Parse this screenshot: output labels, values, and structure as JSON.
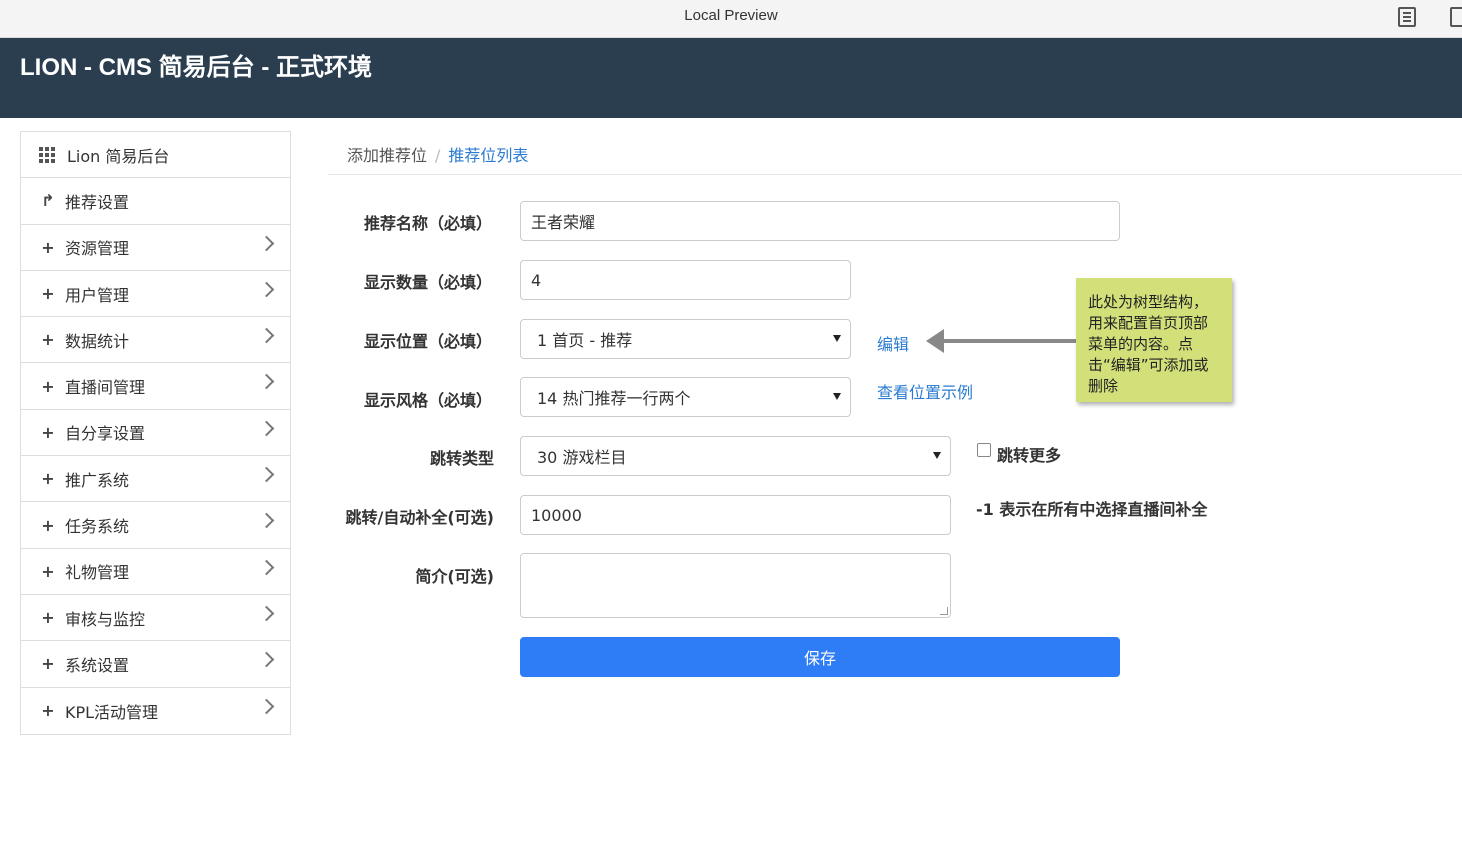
{
  "window": {
    "title": "Local Preview"
  },
  "header": {
    "brand": "LION - CMS 简易后台 - 正式环境"
  },
  "sidebar": {
    "items": [
      {
        "label": "Lion 简易后台",
        "icon": "grid-icon"
      },
      {
        "label": "推荐设置",
        "icon": "share-arrow-icon"
      },
      {
        "label": "资源管理",
        "icon": "plus-icon"
      },
      {
        "label": "用户管理",
        "icon": "plus-icon"
      },
      {
        "label": "数据统计",
        "icon": "plus-icon"
      },
      {
        "label": "直播间管理",
        "icon": "plus-icon"
      },
      {
        "label": "自分享设置",
        "icon": "plus-icon"
      },
      {
        "label": "推广系统",
        "icon": "plus-icon"
      },
      {
        "label": "任务系统",
        "icon": "plus-icon"
      },
      {
        "label": "礼物管理",
        "icon": "plus-icon"
      },
      {
        "label": "审核与监控",
        "icon": "plus-icon"
      },
      {
        "label": "系统设置",
        "icon": "plus-icon"
      },
      {
        "label": "KPL活动管理",
        "icon": "plus-icon"
      }
    ]
  },
  "breadcrumb": {
    "parent": "添加推荐位",
    "separator": "/",
    "current": "推荐位列表"
  },
  "form": {
    "name_label": "推荐名称（必填）",
    "name_value": "王者荣耀",
    "count_label": "显示数量（必填）",
    "count_value": "4",
    "position_label": "显示位置（必填）",
    "position_value": "1 首页 - 推荐",
    "position_edit": "编辑",
    "style_label": "显示风格（必填）",
    "style_value": "14 热门推荐一行两个",
    "style_example": "查看位置示例",
    "jump_type_label": "跳转类型",
    "jump_type_value": "30 游戏栏目",
    "jump_more_label": "跳转更多",
    "jump_more_checked": false,
    "autofill_label": "跳转/自动补全(可选)",
    "autofill_value": "10000",
    "autofill_hint": "-1 表示在所有中选择直播间补全",
    "intro_label": "简介(可选)",
    "intro_value": "",
    "save_label": "保存"
  },
  "annotation": {
    "text": "此处为树型结构，用来配置首页顶部菜单的内容。点击“编辑”可添加或删除"
  },
  "colors": {
    "header_bg": "#2b3e50",
    "accent": "#2f7df6",
    "link": "#2a7bd1",
    "note_bg": "#d3e07a"
  }
}
